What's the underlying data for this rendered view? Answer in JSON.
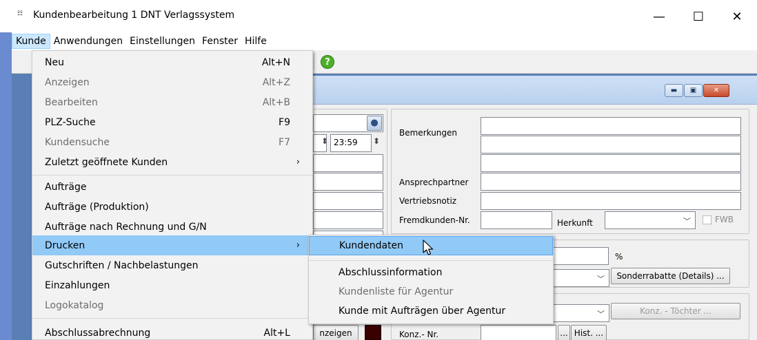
{
  "window": {
    "title": "Kundenbearbeitung 1 DNT Verlagssystem",
    "minimize_glyph": "—",
    "maximize_glyph": "☐",
    "close_glyph": "✕",
    "app_icon_glyph": "☷"
  },
  "menubar": {
    "items": [
      {
        "label": "Kunde",
        "active": true
      },
      {
        "label": "Anwendungen"
      },
      {
        "label": "Einstellungen"
      },
      {
        "label": "Fenster"
      },
      {
        "label": "Hilfe"
      }
    ]
  },
  "toolbar": {
    "help_glyph": "?"
  },
  "inner_window": {
    "min_glyph": "▬",
    "max_glyph": "▣",
    "close_glyph": "✕"
  },
  "form": {
    "time_value": "23:59",
    "label_bemerkungen": "Bemerkungen",
    "label_ansprechpartner": "Ansprechpartner",
    "label_vertriebsnotiz": "Vertriebsnotiz",
    "label_fremdkunden": "Fremdkunden-Nr.",
    "label_herkunft": "Herkunft",
    "label_fwb": "FWB",
    "percent_sign": "%",
    "sonderrabatte_button": "Sonderrabatte (Details) ...",
    "konz_toechter_button": "Konz. - Töchter ...",
    "anzeigen_button": "nzeigen",
    "label_konz_nr": "Konz.- Nr.",
    "dots_button": "...",
    "hist_button": "Hist. ...",
    "chevron_glyph": "﹀",
    "spin_glyph": "⬍"
  },
  "menu_kunde": {
    "items": [
      {
        "label": "Neu",
        "accel": "Alt+N",
        "disabled": false
      },
      {
        "label": "Anzeigen",
        "accel": "Alt+Z",
        "disabled": true
      },
      {
        "label": "Bearbeiten",
        "accel": "Alt+B",
        "disabled": true
      },
      {
        "label": "PLZ-Suche",
        "accel": "F9",
        "disabled": false
      },
      {
        "label": "Kundensuche",
        "accel": "F7",
        "disabled": true
      },
      {
        "label": "Zuletzt geöffnete Kunden",
        "accel": "",
        "arrow": "›",
        "disabled": false
      },
      {
        "label": "Aufträge",
        "accel": "",
        "disabled": false
      },
      {
        "label": "Aufträge (Produktion)",
        "accel": "",
        "disabled": false
      },
      {
        "label": "Aufträge nach Rechnung und G/N",
        "accel": "",
        "disabled": false
      },
      {
        "label": "Drucken",
        "accel": "",
        "arrow": "›",
        "disabled": false,
        "highlight": true
      },
      {
        "label": "Gutschriften / Nachbelastungen",
        "accel": "",
        "disabled": false
      },
      {
        "label": "Einzahlungen",
        "accel": "",
        "disabled": false
      },
      {
        "label": "Logokatalog",
        "accel": "",
        "disabled": true
      },
      {
        "label": "Abschlussabrechnung",
        "accel": "Alt+L",
        "disabled": false
      }
    ]
  },
  "menu_drucken": {
    "items": [
      {
        "label": "Kundendaten",
        "disabled": false,
        "highlight": true
      },
      {
        "label": "Abschlussinformation",
        "disabled": false
      },
      {
        "label": "Kundenliste für Agentur",
        "disabled": true
      },
      {
        "label": "Kunde mit Aufträgen über Agentur",
        "disabled": false
      }
    ]
  }
}
